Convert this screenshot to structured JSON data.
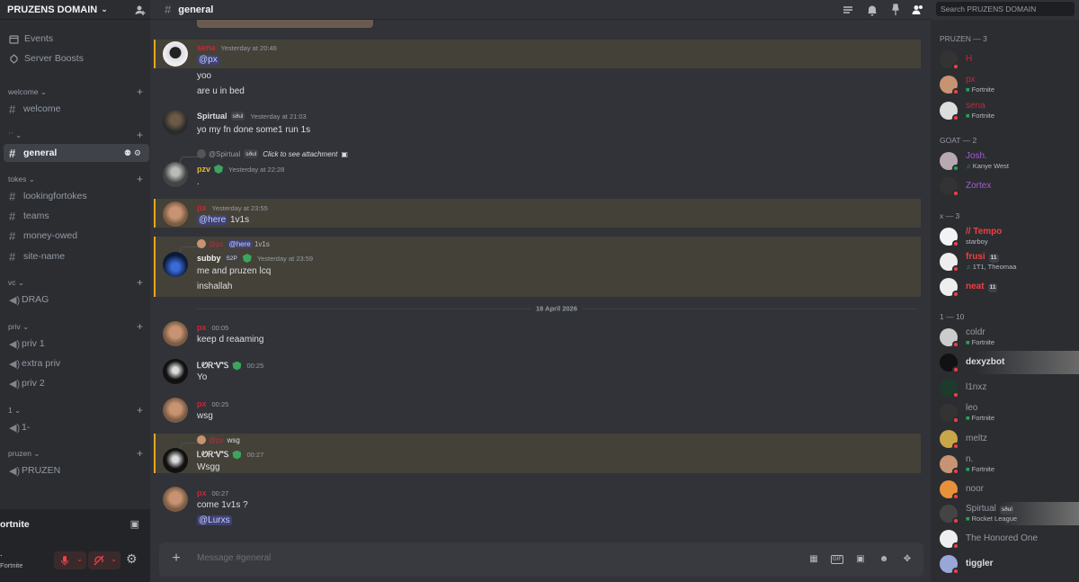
{
  "server": {
    "name": "PRUZENS DOMAIN"
  },
  "sidebar": {
    "top_items": [
      {
        "label": "Events",
        "icon": "calendar-icon"
      },
      {
        "label": "Server Boosts",
        "icon": "boost-icon"
      }
    ],
    "categories": [
      {
        "name": "welcome",
        "channels": [
          {
            "type": "text",
            "name": "welcome"
          }
        ]
      },
      {
        "name": "ˈˈ",
        "channels": [
          {
            "type": "text",
            "name": "general",
            "active": true
          }
        ]
      },
      {
        "name": "tokes",
        "channels": [
          {
            "type": "text",
            "name": "lookingfortokes"
          },
          {
            "type": "text",
            "name": "teams"
          },
          {
            "type": "text",
            "name": "money-owed"
          },
          {
            "type": "text",
            "name": "site-name"
          }
        ]
      },
      {
        "name": "vc",
        "channels": [
          {
            "type": "voice",
            "name": "DRAG"
          }
        ]
      },
      {
        "name": "priv",
        "channels": [
          {
            "type": "voice-locked",
            "name": "priv 1"
          },
          {
            "type": "voice-locked",
            "name": "extra priv"
          },
          {
            "type": "voice-locked",
            "name": "priv 2"
          }
        ]
      },
      {
        "name": "1",
        "channels": [
          {
            "type": "voice-locked",
            "name": "1-"
          }
        ]
      },
      {
        "name": "pruzen",
        "channels": [
          {
            "type": "voice-locked",
            "name": "PRUZEN"
          }
        ]
      }
    ],
    "voice_activity": "ortnite",
    "user": {
      "status": "Fortnite",
      "name_fragment": "."
    }
  },
  "channel": {
    "name": "general",
    "composer_placeholder": "Message #general"
  },
  "messages": [
    {
      "author": "sena",
      "author_color": "#c6283c",
      "time": "Yesterday at 20:46",
      "lines": [
        "@px",
        "yoo",
        "are u in bed"
      ],
      "mention": true
    },
    {
      "author": "Spirtual",
      "author_color": "#dbdee1",
      "tag": "sðul",
      "time": "Yesterday at 21:03",
      "lines": [
        "yo my fn done some1 run 1s"
      ]
    },
    {
      "reply_to": {
        "author": "@Spirtual",
        "tag": "sðul",
        "text": "Click to see attachment"
      },
      "author": "pzv",
      "author_color": "#e9b931",
      "time": "Yesterday at 22:28",
      "lines": [
        "."
      ]
    },
    {
      "author": "px",
      "author_color": "#c6283c",
      "time": "Yesterday at 23:55",
      "lines": [
        "@here 1v1s"
      ],
      "mention": true
    },
    {
      "reply_to": {
        "author": "@px",
        "text": "@here 1v1s"
      },
      "author": "subby",
      "author_color": "#f2f3f5",
      "tag": "S2P",
      "time": "Yesterday at 23:59",
      "lines": [
        "me and pruzen lcq",
        "inshallah"
      ],
      "mention": true
    },
    {
      "divider": "18 April 2026"
    },
    {
      "author": "px",
      "author_color": "#c6283c",
      "time": "00:05",
      "lines": [
        "keep d reaaming"
      ]
    },
    {
      "author": "ᏞᏬᎡᏉᏚ",
      "author_color": "#dbdee1",
      "time": "00:25",
      "lines": [
        "Yo"
      ]
    },
    {
      "author": "px",
      "author_color": "#c6283c",
      "time": "00:25",
      "lines": [
        "wsg"
      ]
    },
    {
      "reply_to": {
        "author": "@px",
        "text": "wsg"
      },
      "author": "ᏞᏬᎡᏉᏚ",
      "author_color": "#dbdee1",
      "time": "00:27",
      "lines": [
        "Wsgg"
      ],
      "mention": true
    },
    {
      "author": "px",
      "author_color": "#c6283c",
      "time": "00:27",
      "lines": [
        "come 1v1s ?",
        "@Lurxs"
      ]
    }
  ],
  "search": {
    "placeholder": "Search PRUZENS DOMAIN"
  },
  "members": {
    "groups": [
      {
        "label": "PRUZEN — 3",
        "members": [
          {
            "name": "H",
            "color": "#c6283c",
            "status": "dnd"
          },
          {
            "name": "px",
            "color": "#c6283c",
            "activity": "Fortnite",
            "status": "dnd"
          },
          {
            "name": "sena",
            "color": "#c6283c",
            "activity": "Fortnite",
            "status": "dnd"
          }
        ]
      },
      {
        "label": "GOAT — 2",
        "members": [
          {
            "name": "Josh.",
            "color": "#a35ad5",
            "activity": "Kanye West",
            "activity_icon": "music",
            "status": "online"
          },
          {
            "name": "Zortex",
            "color": "#a35ad5",
            "status": "dnd"
          }
        ]
      },
      {
        "label": "x — 3",
        "members": [
          {
            "name": "// Tempo",
            "color": "#f23f43",
            "activity": "starboy",
            "status": "dnd"
          },
          {
            "name": "frusi",
            "color": "#f23f43",
            "tag": "11",
            "activity": "1T1, Theomaa",
            "activity_icon": "music",
            "status": "dnd"
          },
          {
            "name": "neat",
            "color": "#f23f43",
            "tag": "11",
            "status": "dnd"
          }
        ]
      },
      {
        "label": "1 — 10",
        "members": [
          {
            "name": "coldr",
            "color": "#949ba4",
            "activity": "Fortnite",
            "status": "dnd"
          },
          {
            "name": "dexyzbot",
            "color": "#dbdee1",
            "status": "dnd"
          },
          {
            "name": "l1nxz",
            "color": "#949ba4",
            "status": "dnd"
          },
          {
            "name": "leo",
            "color": "#949ba4",
            "activity": "Fortnite",
            "status": "dnd"
          },
          {
            "name": "meltz",
            "color": "#949ba4",
            "status": "dnd"
          },
          {
            "name": "n.",
            "color": "#949ba4",
            "activity": "Fortnite",
            "status": "dnd"
          },
          {
            "name": "noor",
            "color": "#949ba4",
            "status": "dnd"
          },
          {
            "name": "Spirtual",
            "color": "#949ba4",
            "tag": "sðul",
            "activity": "Rocket League",
            "status": "dnd"
          },
          {
            "name": "The Honored One",
            "color": "#949ba4",
            "status": "dnd"
          },
          {
            "name": "tiggler",
            "color": "#dbdee1",
            "status": "dnd"
          }
        ]
      }
    ]
  },
  "colors": {
    "accent": "#5865f2",
    "mention_bg": "#444138",
    "mention_border": "#e4a91c",
    "dnd": "#f23f43",
    "online": "#23a55a"
  }
}
